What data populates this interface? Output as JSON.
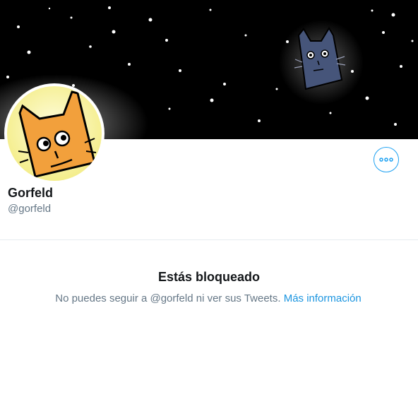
{
  "profile": {
    "display_name": "Gorfeld",
    "handle": "@gorfeld"
  },
  "blocked": {
    "title": "Estás bloqueado",
    "message": "No puedes seguir a @gorfeld ni ver sus Tweets.",
    "link_label": "Más información"
  },
  "icons": {
    "more_button": "more-horizontal-icon"
  },
  "colors": {
    "accent": "#1da1f2",
    "link": "#1b95e0",
    "text_primary": "#14171a",
    "text_secondary": "#657786",
    "divider": "#e6ecf0",
    "banner_bg": "#000000",
    "avatar_bg": "#fbf7a5",
    "cat_orange": "#f2a03c"
  }
}
